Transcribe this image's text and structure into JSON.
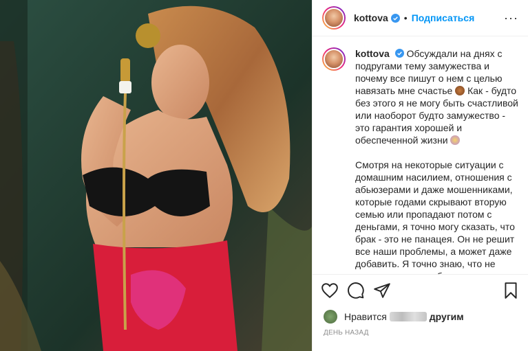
{
  "post": {
    "username": "kottova",
    "follow_label": "Подписаться",
    "dot": "•",
    "more_label": "···",
    "caption_p1": "Обсуждали на днях с подругами тему замужества и почему все пишут о нем с целью навязать мне счастье",
    "caption_p1b": "Как - будто без этого я не могу быть счастливой или наоборот будто замужество - это гарантия хорошей и обеспеченной жизни",
    "caption_p2": "Смотря на некоторые ситуации с домашним насилием, отношения с абьюзерами и даже мошенниками, которые годами скрывают вторую семью или пропадают потом с деньгами, я точно могу сказать, что брак - это не панацея. Он не решит все наши проблемы, а может даже добавить. Я точно знаю, что не готова жить лишь бы с кем в угоду одобрения общества.",
    "likes_prefix": "Нравится",
    "likes_suffix": "другим",
    "time_label": "ДЕНЬ НАЗАД"
  },
  "icons": [
    "verified-badge-icon",
    "more-options-icon",
    "heart-icon",
    "comment-icon",
    "share-icon",
    "bookmark-icon"
  ],
  "colors": {
    "accent": "#0095f6",
    "text": "#262626",
    "muted": "#8e8e8e",
    "border": "#efefef"
  }
}
